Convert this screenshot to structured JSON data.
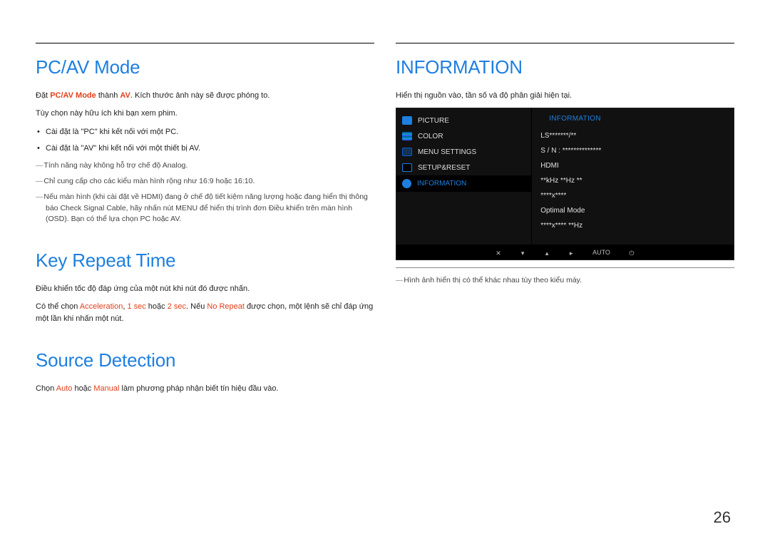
{
  "page_number": "26",
  "left": {
    "pcav": {
      "title": "PC/AV Mode",
      "para1": {
        "pre": "Đặt ",
        "hl": "PC/AV Mode",
        "mid": " thành ",
        "hl2": "AV",
        "post": ". Kích thước ảnh này sẽ được phóng to."
      },
      "para2": "Tùy chọn này hữu ích khi bạn xem phim.",
      "bullets": [
        {
          "pre": "Cài đặt là ",
          "v": "\"PC\"",
          "post": " khi kết nối với một PC.",
          "cls": "pc"
        },
        {
          "pre": "Cài đặt là ",
          "v": "\"AV\"",
          "post": " khi kết nối với một thiết bị AV.",
          "cls": "av"
        }
      ],
      "foot1": {
        "pre": "Tính năng này không hỗ trợ chế độ ",
        "hl": "Analog",
        "post": "."
      },
      "foot2": "Chỉ cung cấp cho các kiểu màn hình rộng như 16:9 hoặc 16:10.",
      "foot3": {
        "pre": "Nếu màn hình (khi cài đặt về HDMI) đang ở chế độ  tiết kiệm năng lượng hoặc đang hiển thị thông báo ",
        "hl1": "Check Signal Cable",
        "mid1": ", hãy nhấn nút ",
        "bold": "MENU",
        "mid2": " để hiển thị trình đơn Điều khiển trên màn hình (OSD). Bạn có thể lựa chọn ",
        "hl2": "PC",
        "mid3": " hoặc ",
        "hl3": "AV",
        "post": "."
      }
    },
    "krt": {
      "title": "Key Repeat Time",
      "p1": "Điều khiển tốc độ đáp ứng của một nút khi nút đó được nhấn.",
      "p2": {
        "pre": "Có thể chọn ",
        "h1": "Acceleration",
        "s1": ", ",
        "h2": "1 sec",
        "s2": " hoặc ",
        "h3": "2 sec",
        "s3": ". Nếu ",
        "h4": "No Repeat",
        "post": " được chọn, một lệnh sẽ chỉ đáp ứng một lần khi nhấn một nút."
      }
    },
    "sd": {
      "title": "Source Detection",
      "p": {
        "pre": "Chọn ",
        "h1": "Auto",
        "mid": " hoặc ",
        "h2": "Manual",
        "post": " làm phương pháp nhận biết tín hiệu đầu vào."
      }
    }
  },
  "right": {
    "title": "INFORMATION",
    "desc": "Hiển thị nguồn vào, tần số và độ phân giải hiện tại.",
    "osd": {
      "header": "INFORMATION",
      "menu": [
        {
          "icon": "picture",
          "label": "PICTURE"
        },
        {
          "icon": "color",
          "label": "COLOR"
        },
        {
          "icon": "menu",
          "label": "MENU SETTINGS"
        },
        {
          "icon": "reset",
          "label": "SETUP&RESET"
        },
        {
          "icon": "info",
          "label": "INFORMATION",
          "active": true
        }
      ],
      "info_lines": [
        "LS*******/**",
        "S / N : **************",
        "",
        "HDMI",
        "**kHz **Hz **",
        "****x****",
        "",
        "Optimal Mode",
        "****x**** **Hz"
      ],
      "footer_keys": [
        "✕",
        "▾",
        "▴",
        "▸",
        "AUTO",
        "⏻"
      ]
    },
    "note": "Hình ảnh hiển thị có thể khác nhau tùy theo kiểu máy."
  }
}
